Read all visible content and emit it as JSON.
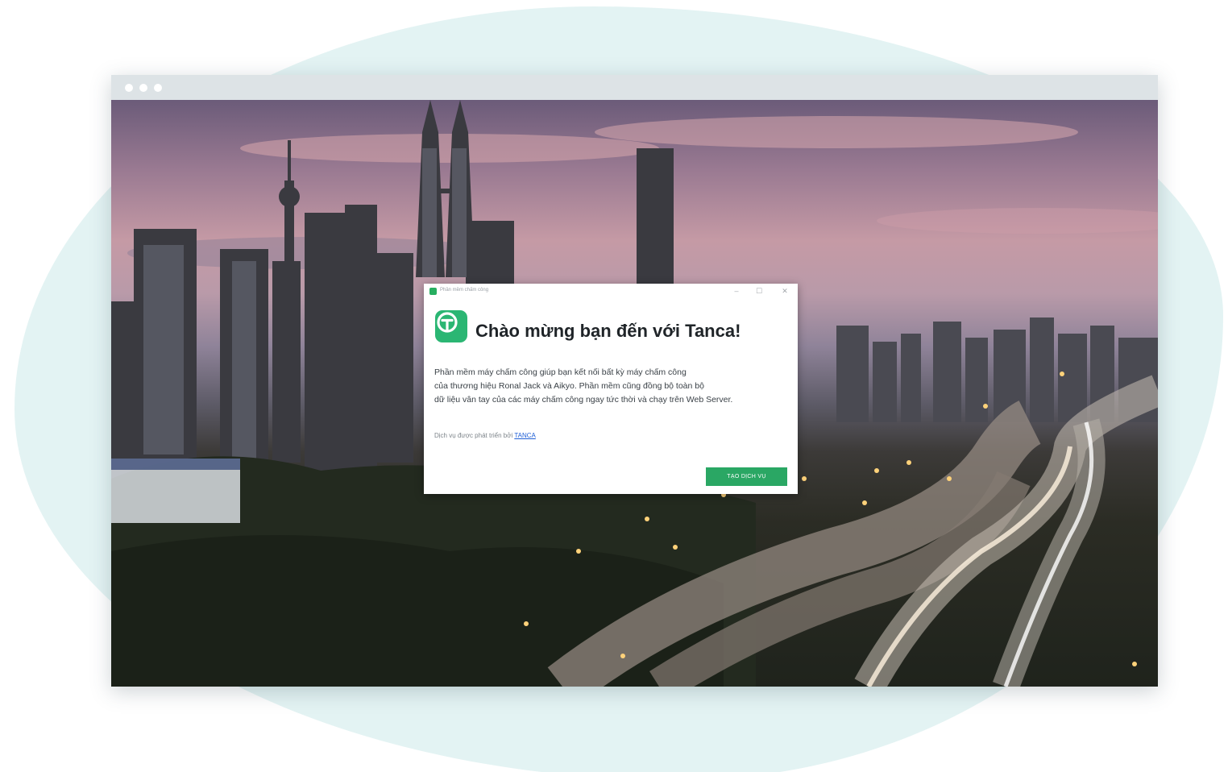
{
  "dialog": {
    "window_title": "Phần mềm chấm công",
    "heading": "Chào mừng bạn đến với Tanca!",
    "description_lines": [
      "Phần mềm máy chấm công giúp bạn kết nối bất kỳ máy chấm công",
      "của thương hiệu Ronal Jack và Aikyo. Phần mềm cũng đồng bộ toàn bộ",
      "dữ liệu vân tay của các máy chấm công ngay tức thời và chạy trên Web Server."
    ],
    "developer_prefix": "Dịch vụ được phát triển bởi",
    "developer_link": "TANCA",
    "create_button": "TẠO DỊCH VỤ",
    "controls": {
      "minimize": "–",
      "maximize": "☐",
      "close": "✕"
    }
  },
  "icons": {
    "app": "tanca-logo-icon",
    "window_dots": [
      "dot-icon",
      "dot-icon",
      "dot-icon"
    ]
  },
  "colors": {
    "brand_green": "#2bb673",
    "button_green": "#2aa764",
    "link_blue": "#1f5fd6",
    "backdrop_teal": "#e3f3f3"
  }
}
